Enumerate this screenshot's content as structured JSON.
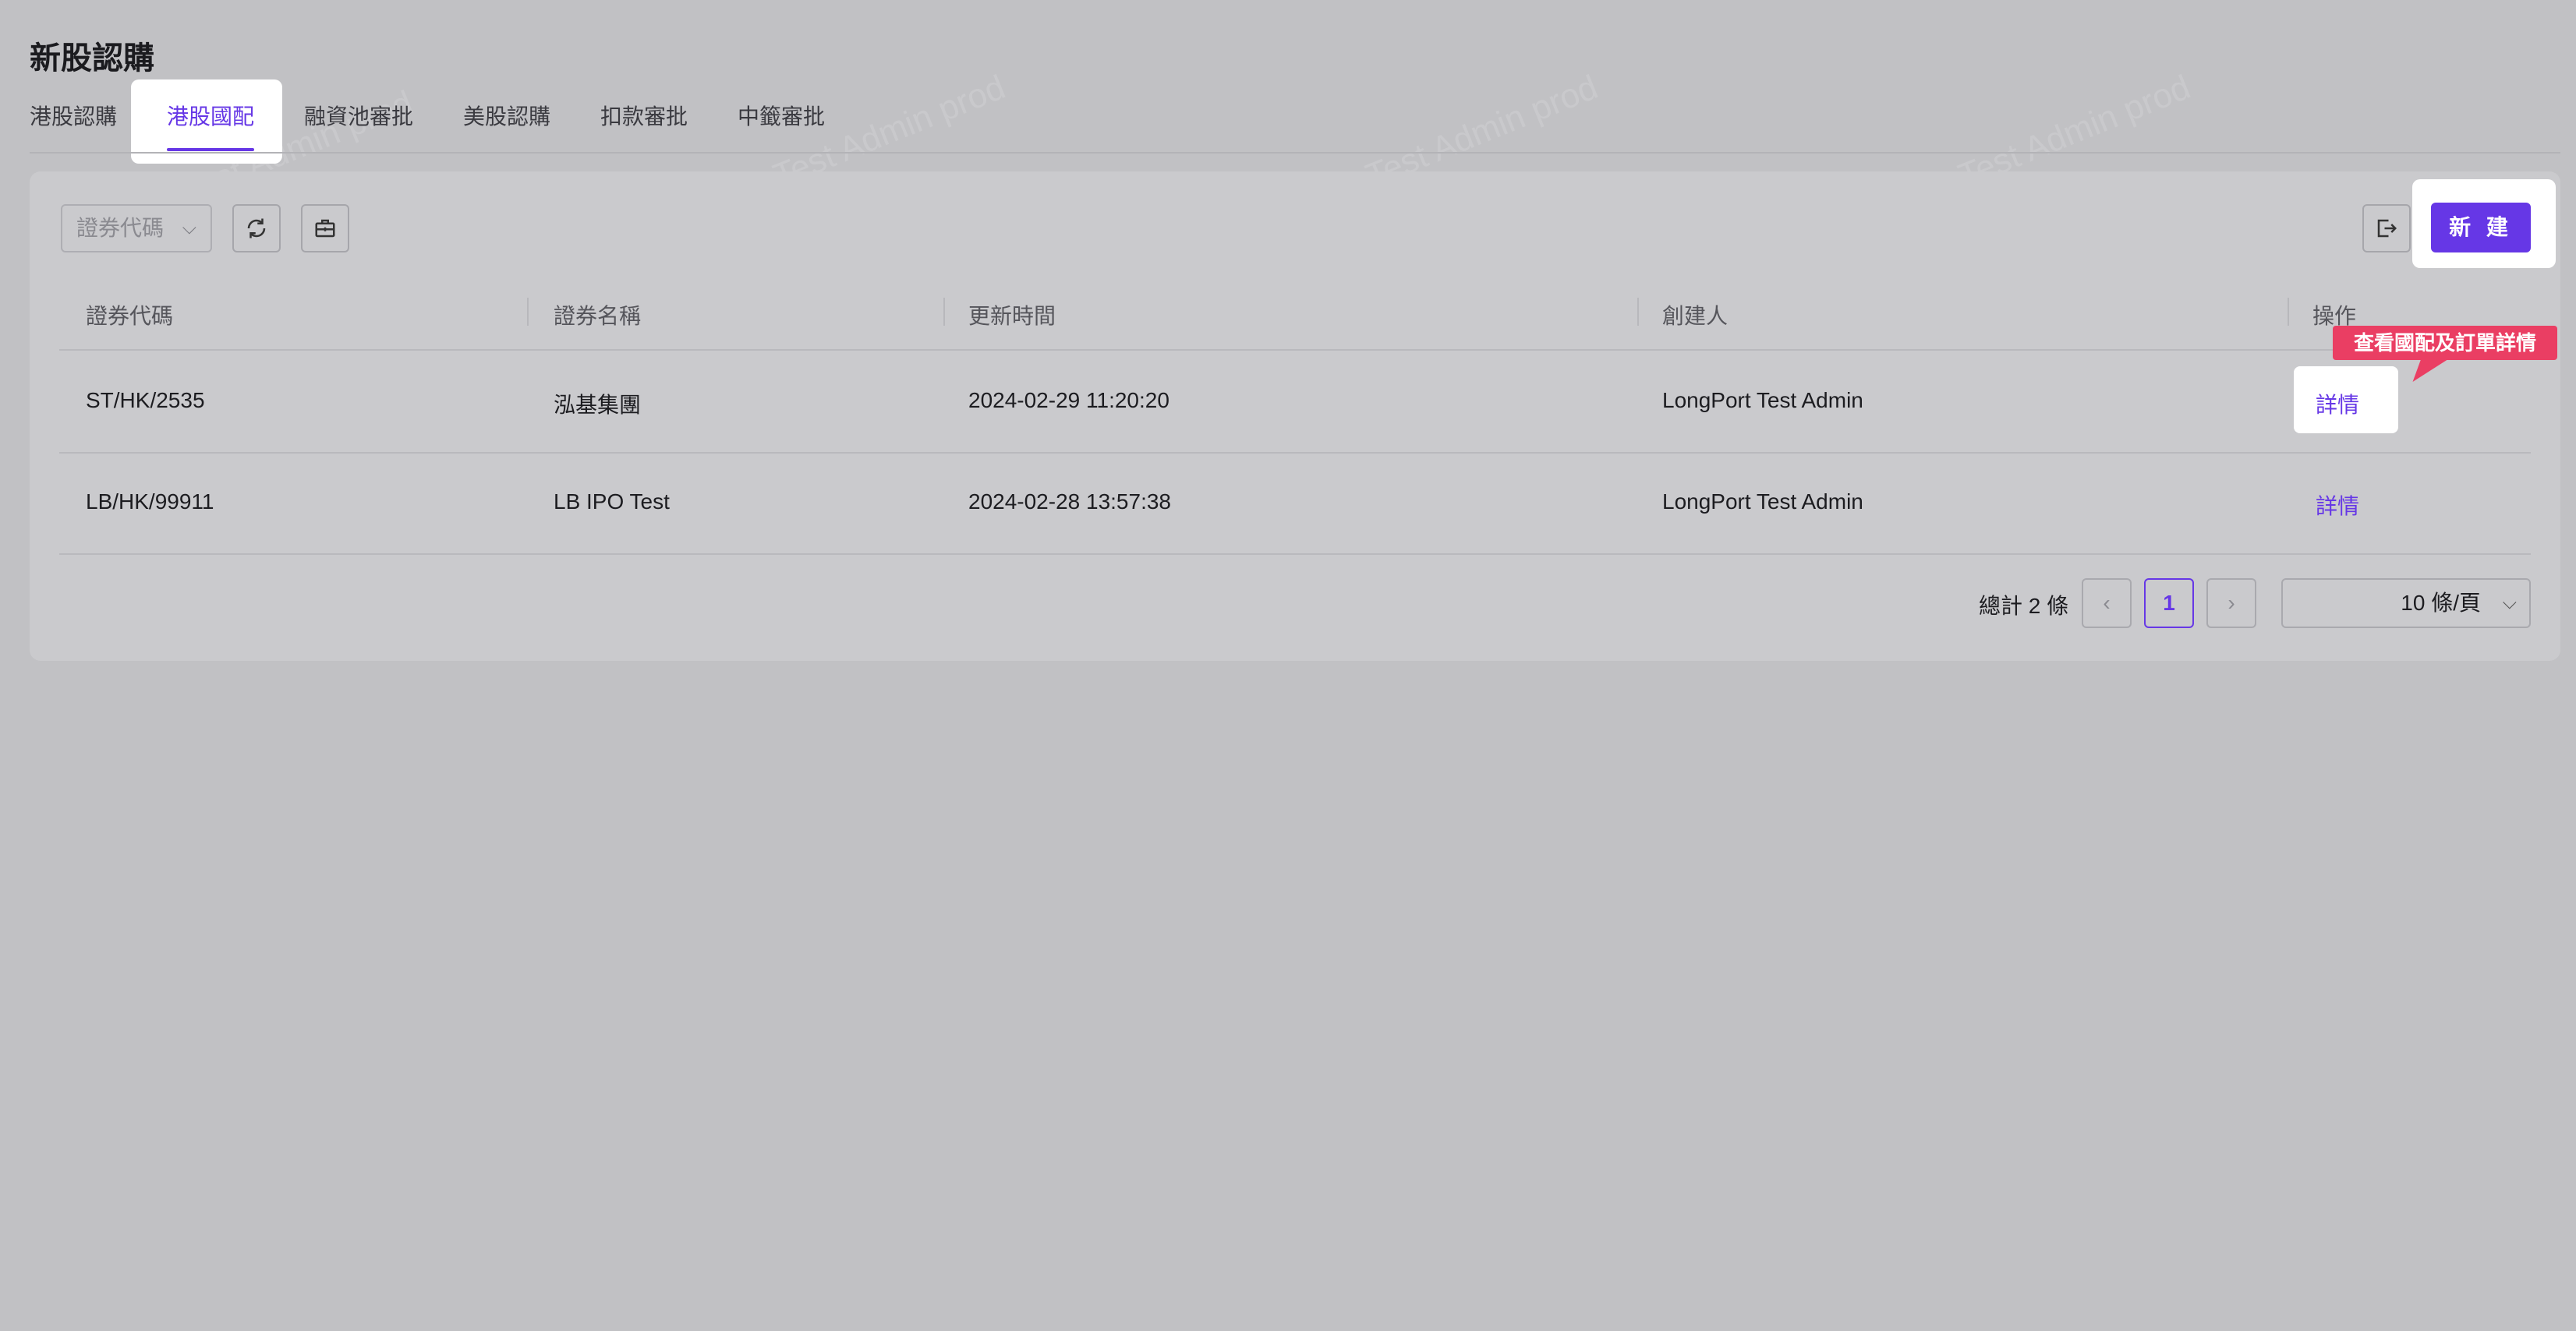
{
  "page_title": "新股認購",
  "tabs": [
    {
      "label": "港股認購",
      "active": false
    },
    {
      "label": "港股國配",
      "active": true
    },
    {
      "label": "融資池審批",
      "active": false
    },
    {
      "label": "美股認購",
      "active": false
    },
    {
      "label": "扣款審批",
      "active": false
    },
    {
      "label": "中籤審批",
      "active": false
    }
  ],
  "toolbar": {
    "select_placeholder": "證券代碼",
    "refresh_icon": "refresh-icon",
    "toolbox_icon": "toolbox-icon",
    "export_icon": "export-icon",
    "new_label": "新 建"
  },
  "table": {
    "columns": [
      "證券代碼",
      "證券名稱",
      "更新時間",
      "創建人",
      "操作"
    ],
    "rows": [
      {
        "code": "ST/HK/2535",
        "name": "泓基集團",
        "updated": "2024-02-29 11:20:20",
        "creator": "LongPort Test Admin",
        "action": "詳情"
      },
      {
        "code": "LB/HK/99911",
        "name": "LB IPO Test",
        "updated": "2024-02-28 13:57:38",
        "creator": "LongPort Test Admin",
        "action": "詳情"
      }
    ]
  },
  "tooltip": "查看國配及訂單詳情",
  "pagination": {
    "total": "總計 2 條",
    "prev": "‹",
    "current": "1",
    "next": "›",
    "page_size": "10 條/頁"
  },
  "watermark": "LongPort Test Admin prod",
  "colors": {
    "accent": "#6637e6",
    "tooltip": "#ea3e63",
    "background": "#c1c1c4"
  }
}
